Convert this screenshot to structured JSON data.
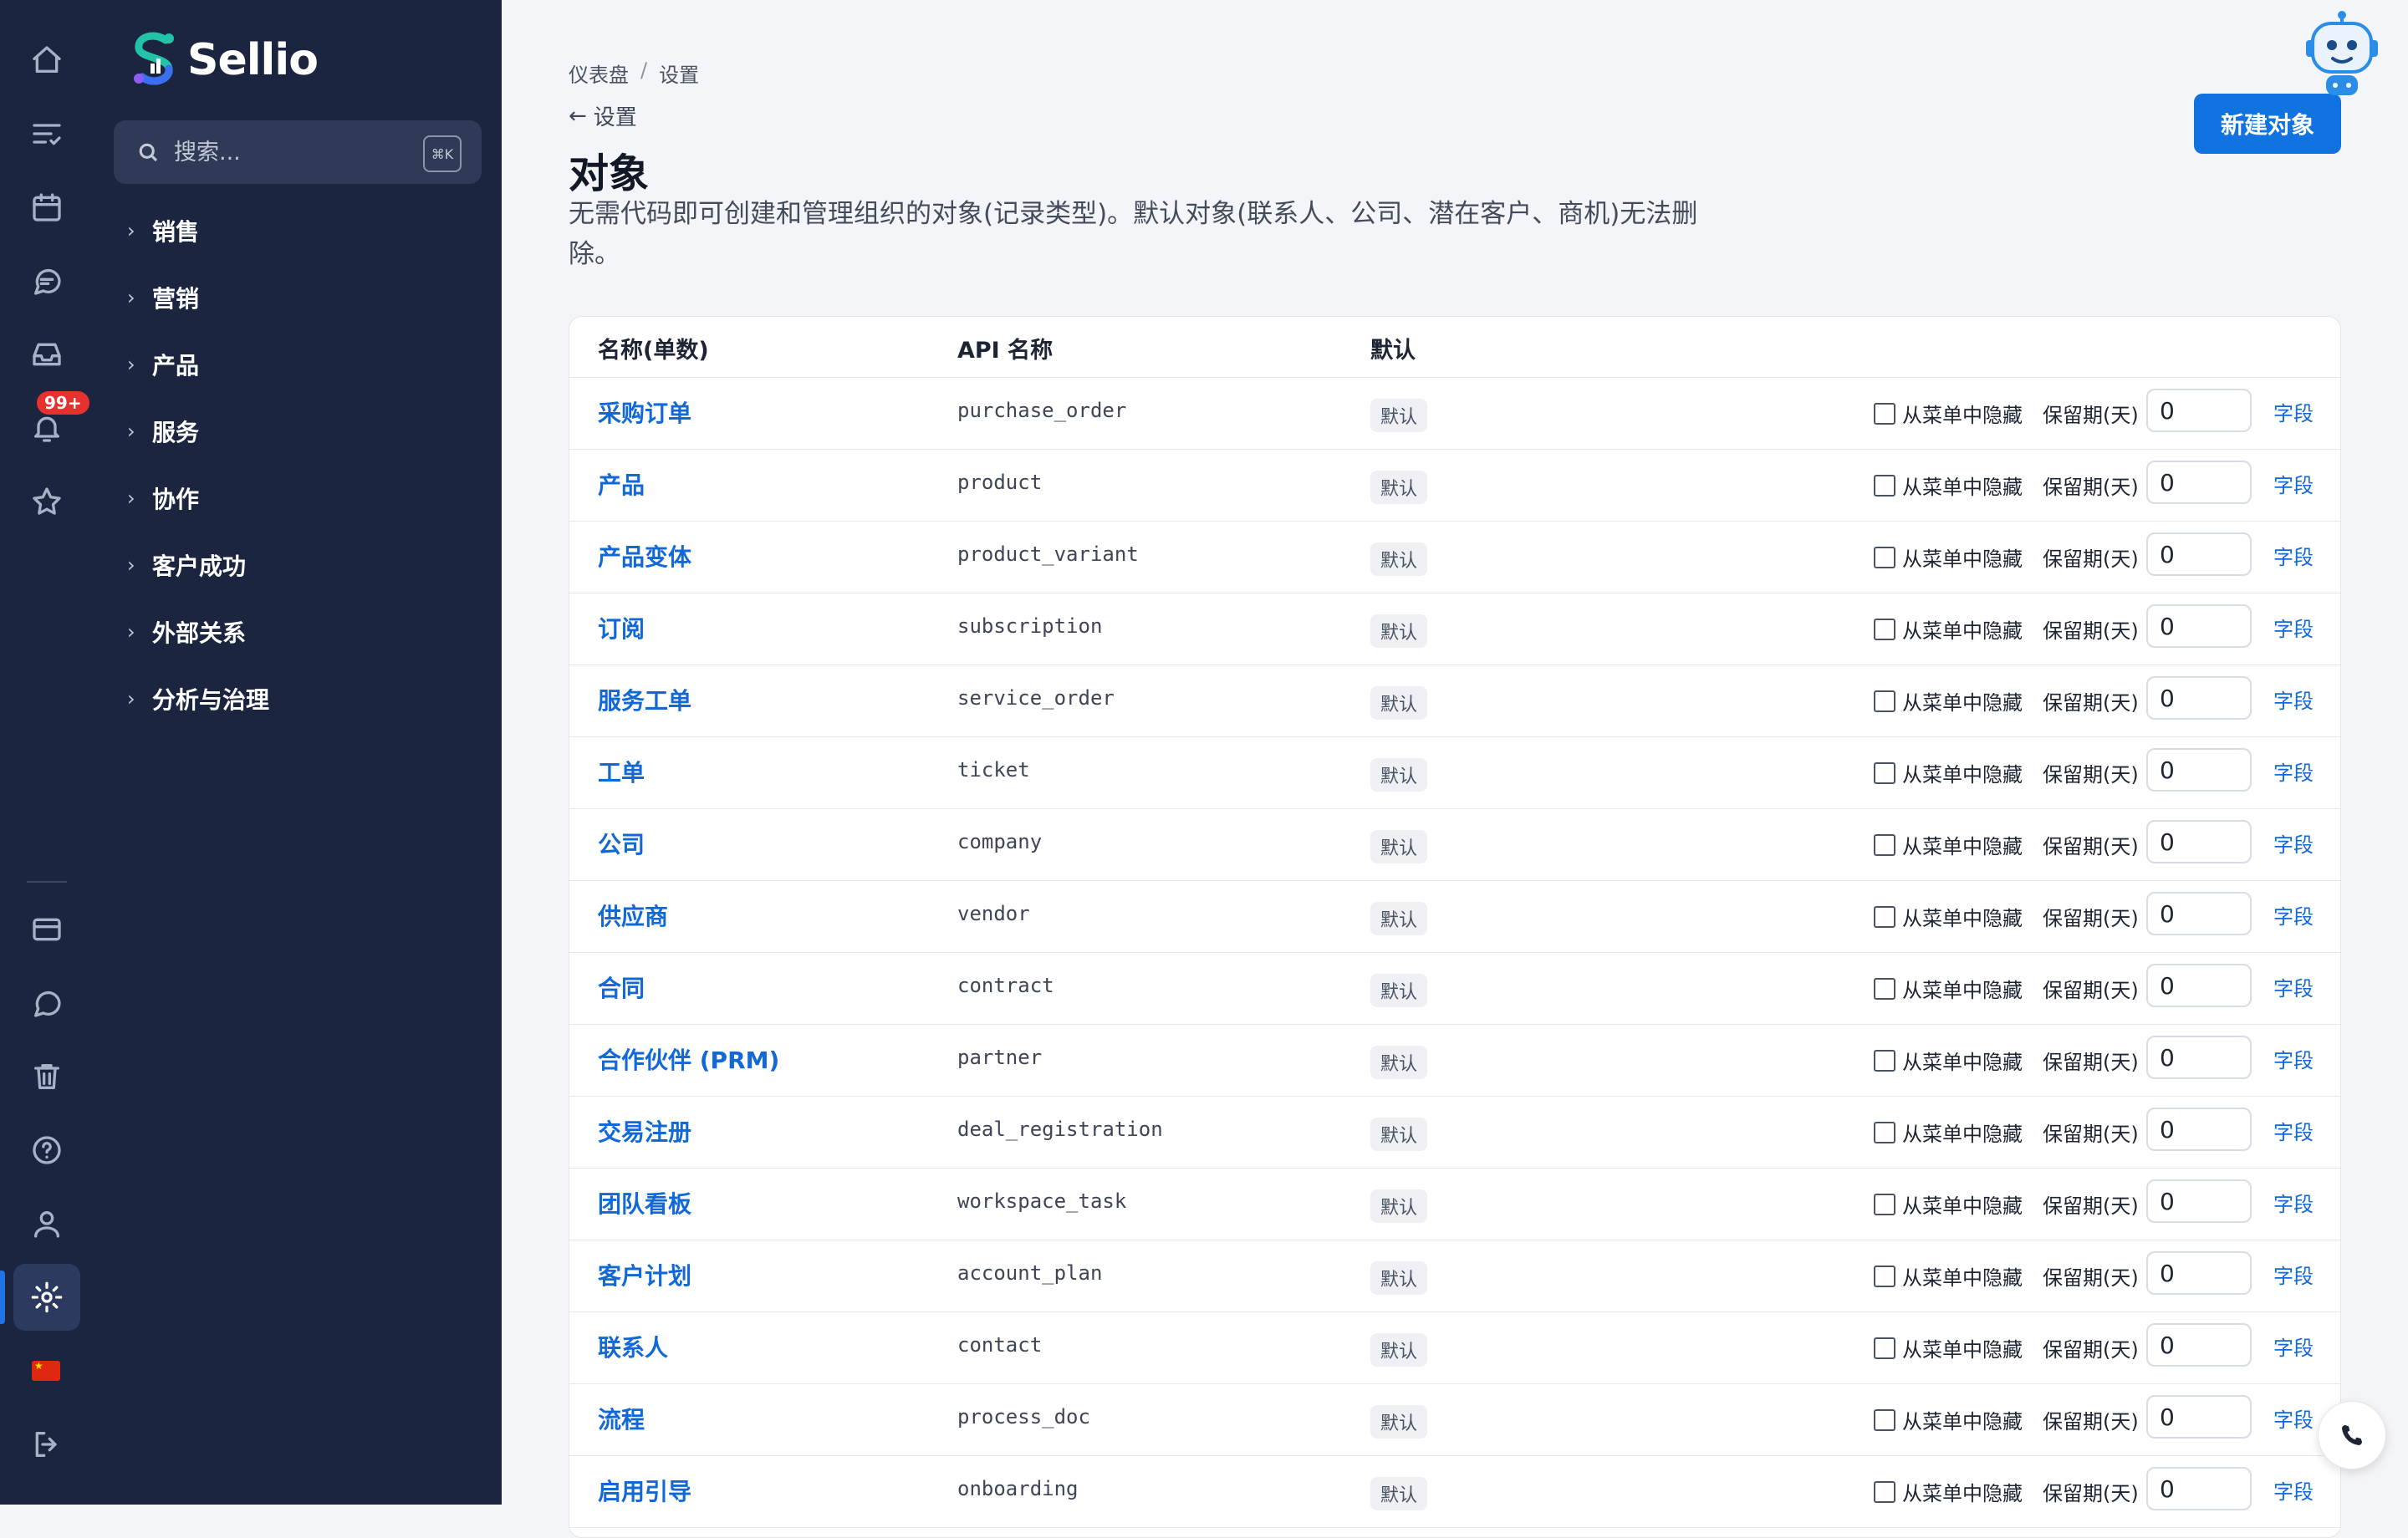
{
  "app": {
    "name": "Sellio"
  },
  "rail": {
    "notification_badge": "99+",
    "accent_color": "#1f74e8",
    "icons_top": [
      "home-icon",
      "tasks-icon",
      "calendar-icon",
      "chat-icon",
      "inbox-icon",
      "bell-icon",
      "star-icon"
    ],
    "icons_bottom": [
      "billing-card-icon",
      "message-icon",
      "trash-icon",
      "help-icon",
      "user-icon",
      "settings-icon",
      "language-flag-icon",
      "logout-icon"
    ]
  },
  "sidebar": {
    "search_placeholder": "搜索...",
    "search_shortcut": "⌘K",
    "groups": [
      {
        "label": "销售"
      },
      {
        "label": "营销"
      },
      {
        "label": "产品"
      },
      {
        "label": "服务"
      },
      {
        "label": "协作"
      },
      {
        "label": "客户成功"
      },
      {
        "label": "外部关系"
      },
      {
        "label": "分析与治理"
      }
    ]
  },
  "breadcrumb": {
    "items": [
      "仪表盘",
      "设置"
    ],
    "separator": "/"
  },
  "back_link": "设置",
  "page": {
    "title": "对象",
    "description": "无需代码即可创建和管理组织的对象(记录类型)。默认对象(联系人、公司、潜在客户、商机)无法删除。",
    "new_button": "新建对象"
  },
  "table": {
    "headers": {
      "name": "名称(单数)",
      "api": "API 名称",
      "default": "默认"
    },
    "hide_label": "从菜单中隐藏",
    "retention_label": "保留期(天)",
    "fields_link": "字段",
    "rows": [
      {
        "name": "采购订单",
        "api": "purchase_order",
        "badge": "默认",
        "retention": "0"
      },
      {
        "name": "产品",
        "api": "product",
        "badge": "默认",
        "retention": "0"
      },
      {
        "name": "产品变体",
        "api": "product_variant",
        "badge": "默认",
        "retention": "0"
      },
      {
        "name": "订阅",
        "api": "subscription",
        "badge": "默认",
        "retention": "0"
      },
      {
        "name": "服务工单",
        "api": "service_order",
        "badge": "默认",
        "retention": "0"
      },
      {
        "name": "工单",
        "api": "ticket",
        "badge": "默认",
        "retention": "0"
      },
      {
        "name": "公司",
        "api": "company",
        "badge": "默认",
        "retention": "0"
      },
      {
        "name": "供应商",
        "api": "vendor",
        "badge": "默认",
        "retention": "0"
      },
      {
        "name": "合同",
        "api": "contract",
        "badge": "默认",
        "retention": "0"
      },
      {
        "name": "合作伙伴 (PRM)",
        "api": "partner",
        "badge": "默认",
        "retention": "0"
      },
      {
        "name": "交易注册",
        "api": "deal_registration",
        "badge": "默认",
        "retention": "0"
      },
      {
        "name": "团队看板",
        "api": "workspace_task",
        "badge": "默认",
        "retention": "0"
      },
      {
        "name": "客户计划",
        "api": "account_plan",
        "badge": "默认",
        "retention": "0"
      },
      {
        "name": "联系人",
        "api": "contact",
        "badge": "默认",
        "retention": "0"
      },
      {
        "name": "流程",
        "api": "process_doc",
        "badge": "默认",
        "retention": "0"
      },
      {
        "name": "启用引导",
        "api": "onboarding",
        "badge": "默认",
        "retention": "0"
      }
    ]
  },
  "colors": {
    "primary": "#1173e0",
    "sidebar_bg": "#1b2540",
    "link": "#1269d6",
    "badge_red": "#e5322e"
  }
}
